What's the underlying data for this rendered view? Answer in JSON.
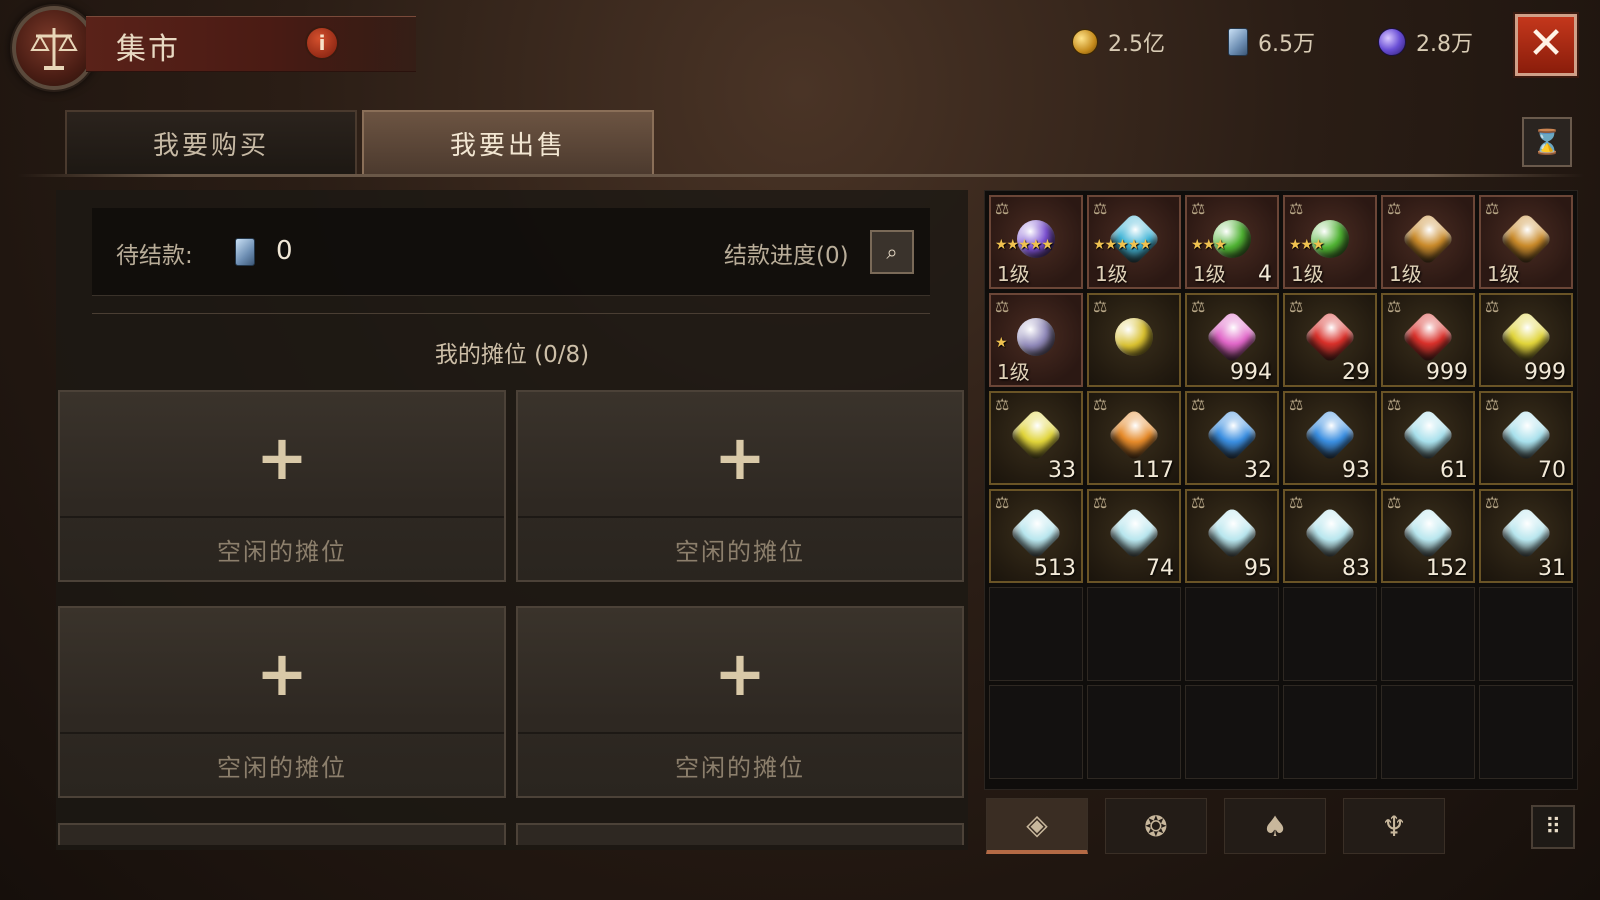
{
  "header": {
    "title": "集市",
    "info_icon": "i",
    "currencies": [
      {
        "icon": "gold-coin-icon",
        "value": "2.5亿"
      },
      {
        "icon": "ticket-icon",
        "value": "6.5万"
      },
      {
        "icon": "orb-icon",
        "value": "2.8万"
      }
    ],
    "close_icon": "✕"
  },
  "tabs": [
    {
      "label": "我要购买",
      "active": false
    },
    {
      "label": "我要出售",
      "active": true
    }
  ],
  "history_icon": "⌛",
  "settlement": {
    "label": "待结款:",
    "value": "0",
    "progress_label": "结款进度(0)",
    "progress_icon": "⌕"
  },
  "stalls": {
    "title": "我的摊位 (0/8)",
    "slots": [
      {
        "plus": "+",
        "label": "空闲的摊位"
      },
      {
        "plus": "+",
        "label": "空闲的摊位"
      },
      {
        "plus": "+",
        "label": "空闲的摊位"
      },
      {
        "plus": "+",
        "label": "空闲的摊位"
      }
    ]
  },
  "inventory": {
    "scale_icon": "⚖",
    "items": [
      {
        "kind": "round",
        "color": "#7a4fd0",
        "level": "1级",
        "stars": "★★★★★",
        "count": "",
        "rare": true
      },
      {
        "kind": "diamond",
        "color": "#3fb4d6",
        "level": "1级",
        "stars": "★★★★★",
        "count": "",
        "rare": true
      },
      {
        "kind": "round",
        "color": "#4fb233",
        "level": "1级",
        "stars": "★★★",
        "count": "4",
        "rare": true
      },
      {
        "kind": "round",
        "color": "#4fb233",
        "level": "1级",
        "stars": "★★★",
        "count": "",
        "rare": true
      },
      {
        "kind": "diamond",
        "color": "#c98a2a",
        "level": "1级",
        "stars": "",
        "count": "",
        "rare": true
      },
      {
        "kind": "diamond",
        "color": "#c98a2a",
        "level": "1级",
        "stars": "",
        "count": "",
        "rare": true
      },
      {
        "kind": "round",
        "color": "#8f88b8",
        "level": "1级",
        "stars": "★",
        "count": "",
        "rare": true
      },
      {
        "kind": "round",
        "color": "#d8c030",
        "level": "",
        "stars": "",
        "count": "",
        "rare": false
      },
      {
        "kind": "diamond",
        "color": "#e067c8",
        "level": "",
        "stars": "",
        "count": "994",
        "rare": false
      },
      {
        "kind": "diamond",
        "color": "#d8302a",
        "level": "",
        "stars": "",
        "count": "29",
        "rare": false
      },
      {
        "kind": "diamond",
        "color": "#d8302a",
        "level": "",
        "stars": "",
        "count": "999",
        "rare": false
      },
      {
        "kind": "diamond",
        "color": "#e0d43a",
        "level": "",
        "stars": "",
        "count": "999",
        "rare": false
      },
      {
        "kind": "diamond",
        "color": "#e0d43a",
        "level": "",
        "stars": "",
        "count": "33",
        "rare": false
      },
      {
        "kind": "diamond",
        "color": "#e58a2a",
        "level": "",
        "stars": "",
        "count": "117",
        "rare": false
      },
      {
        "kind": "diamond",
        "color": "#3a8ee0",
        "level": "",
        "stars": "",
        "count": "32",
        "rare": false
      },
      {
        "kind": "diamond",
        "color": "#3a8ee0",
        "level": "",
        "stars": "",
        "count": "93",
        "rare": false
      },
      {
        "kind": "diamond",
        "color": "#a8e0ec",
        "level": "",
        "stars": "",
        "count": "61",
        "rare": false
      },
      {
        "kind": "diamond",
        "color": "#a8e0ec",
        "level": "",
        "stars": "",
        "count": "70",
        "rare": false
      },
      {
        "kind": "diamond",
        "color": "#b8e6ee",
        "level": "",
        "stars": "",
        "count": "513",
        "rare": false
      },
      {
        "kind": "diamond",
        "color": "#b8e6ee",
        "level": "",
        "stars": "",
        "count": "74",
        "rare": false
      },
      {
        "kind": "diamond",
        "color": "#b8e6ee",
        "level": "",
        "stars": "",
        "count": "95",
        "rare": false
      },
      {
        "kind": "diamond",
        "color": "#b8e6ee",
        "level": "",
        "stars": "",
        "count": "83",
        "rare": false
      },
      {
        "kind": "diamond",
        "color": "#b8e6ee",
        "level": "",
        "stars": "",
        "count": "152",
        "rare": false
      },
      {
        "kind": "diamond",
        "color": "#b8e6ee",
        "level": "",
        "stars": "",
        "count": "31",
        "rare": false
      }
    ],
    "empty_slots": 12
  },
  "inventory_tabs": [
    {
      "icon": "gem-tab-icon",
      "glyph": "◈",
      "active": true
    },
    {
      "icon": "rune-tab-icon",
      "glyph": "❂",
      "active": false
    },
    {
      "icon": "bag-tab-icon",
      "glyph": "♠",
      "active": false
    },
    {
      "icon": "demon-tab-icon",
      "glyph": "♆",
      "active": false
    }
  ],
  "grid_icon": "⠿"
}
